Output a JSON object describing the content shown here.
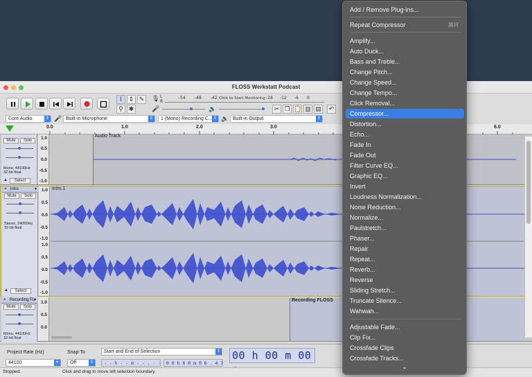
{
  "window": {
    "title": "FLOSS Werkstatt Podcast"
  },
  "meter": {
    "ticks": [
      "-54",
      "-48",
      "-42",
      "-18",
      "-12",
      "-6",
      "0"
    ],
    "click_to_monitor": "Click to Start Monitoring",
    "lr_top": "L\nR"
  },
  "device_bar": {
    "host": "Core Audio",
    "input_device": "Built-in Microphone",
    "channels": "1 (Mono) Recording C...",
    "output_device": "Built-in Output"
  },
  "ruler": {
    "ticks": [
      "0.0",
      "1.0",
      "2.0",
      "3.0",
      "6.0"
    ]
  },
  "tracks": [
    {
      "name": "",
      "clip_name": "Audio Track",
      "mute": "Mute",
      "solo": "Solo",
      "info_line1": "Mono, 44100Hz",
      "info_line2": "32-bit float",
      "select": "Select",
      "scale": [
        "1.0",
        "0.5",
        "0.0",
        "-0.5",
        "-1.0"
      ]
    },
    {
      "name": "intro",
      "clip_name": "intro.1",
      "mute": "Mute",
      "solo": "Solo",
      "info_line1": "Stereo, 24000Hz",
      "info_line2": "32-bit float",
      "select": "Select",
      "scale_top": [
        "1.0",
        "0.5",
        "0.0",
        "-0.5",
        "-1.0"
      ],
      "scale_bottom": [
        "1.0",
        "0.5",
        "0.0",
        "-0.5",
        "-1.0"
      ]
    },
    {
      "name": "Recording FL",
      "clip_name": "Recording FLOSS",
      "mute": "Mute",
      "solo": "Solo",
      "info_line1": "Mono, 44100Hz",
      "info_line2": "32-bit float",
      "scale": [
        "1.0",
        "0.5",
        "0.0"
      ]
    }
  ],
  "selection_bar": {
    "project_rate_label": "Project Rate (Hz)",
    "project_rate_value": "44100",
    "snap_to_label": "Snap-To",
    "snap_to_value": "Off",
    "selection_mode": "Start and End of Selection",
    "start_time": "- - h - - m - - . - - - s",
    "end_time": "0 0 h 0 0 m 0 6 . 4 7 0 s",
    "big_time": "00 h 00 m 00 s"
  },
  "status": {
    "state": "Stopped.",
    "hint": "Click and drag to move left selection boundary."
  },
  "menu": {
    "items": [
      {
        "label": "Add / Remove Plug-ins...",
        "shortcut": ""
      },
      {
        "label": "Repeat Compressor",
        "shortcut": "⌘R"
      },
      {
        "label": "Amplify...",
        "shortcut": ""
      },
      {
        "label": "Auto Duck...",
        "shortcut": ""
      },
      {
        "label": "Bass and Treble...",
        "shortcut": ""
      },
      {
        "label": "Change Pitch...",
        "shortcut": ""
      },
      {
        "label": "Change Speed...",
        "shortcut": ""
      },
      {
        "label": "Change Tempo...",
        "shortcut": ""
      },
      {
        "label": "Click Removal...",
        "shortcut": ""
      },
      {
        "label": "Compressor...",
        "shortcut": ""
      },
      {
        "label": "Distortion...",
        "shortcut": ""
      },
      {
        "label": "Echo...",
        "shortcut": ""
      },
      {
        "label": "Fade In",
        "shortcut": ""
      },
      {
        "label": "Fade Out",
        "shortcut": ""
      },
      {
        "label": "Filter Curve EQ...",
        "shortcut": ""
      },
      {
        "label": "Graphic EQ...",
        "shortcut": ""
      },
      {
        "label": "Invert",
        "shortcut": ""
      },
      {
        "label": "Loudness Normalization...",
        "shortcut": ""
      },
      {
        "label": "Noise Reduction...",
        "shortcut": ""
      },
      {
        "label": "Normalize...",
        "shortcut": ""
      },
      {
        "label": "Paulstretch...",
        "shortcut": ""
      },
      {
        "label": "Phaser...",
        "shortcut": ""
      },
      {
        "label": "Repair",
        "shortcut": ""
      },
      {
        "label": "Repeat...",
        "shortcut": ""
      },
      {
        "label": "Reverb...",
        "shortcut": ""
      },
      {
        "label": "Reverse",
        "shortcut": ""
      },
      {
        "label": "Sliding Stretch...",
        "shortcut": ""
      },
      {
        "label": "Truncate Silence...",
        "shortcut": ""
      },
      {
        "label": "Wahwah...",
        "shortcut": ""
      },
      {
        "label": "Adjustable Fade...",
        "shortcut": ""
      },
      {
        "label": "Clip Fix...",
        "shortcut": ""
      },
      {
        "label": "Crossfade Clips",
        "shortcut": ""
      },
      {
        "label": "Crossfade Tracks...",
        "shortcut": ""
      }
    ],
    "highlighted": "Compressor...",
    "more_indicator": "⌄"
  },
  "colors": {
    "desktop": "#2e3d4e",
    "menu_bg": "#5c5c5c",
    "menu_highlight": "#3a7ee3",
    "waveform": "#3f4fc9",
    "waveform_bg": "#bfc3d6",
    "big_time_text": "#1c2f8c"
  }
}
